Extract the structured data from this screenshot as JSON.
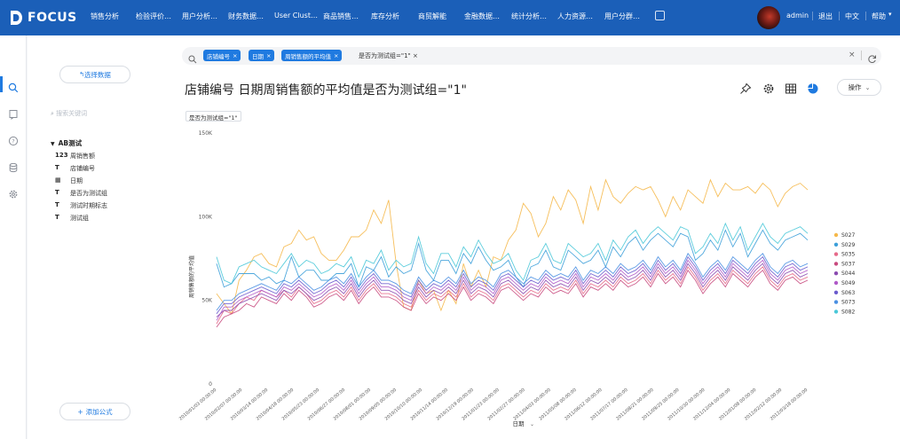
{
  "app": {
    "logo_text": "FOCUS"
  },
  "nav": [
    "销售分析",
    "检验评价…",
    "用户分析…",
    "财务数据…",
    "User Clust…",
    "商品销售…",
    "库存分析",
    "商贸解能",
    "金融数据…",
    "统计分析…",
    "人力资源…",
    "用户分群…"
  ],
  "user": {
    "name": "admin",
    "logout": "退出",
    "lang": "中文",
    "help": "帮助"
  },
  "left": {
    "select_data": "选择数据",
    "search_placeholder": "搜索关键词",
    "tree_title": "AB测试",
    "fields": [
      {
        "type": "123",
        "label": "周销售额"
      },
      {
        "type": "T",
        "label": "店铺编号"
      },
      {
        "type": "cal",
        "label": "日期"
      },
      {
        "type": "T",
        "label": "是否为测试组"
      },
      {
        "type": "T",
        "label": "测试时期标志"
      },
      {
        "type": "T",
        "label": "测试组"
      }
    ],
    "add_formula": "添加公式"
  },
  "filter": {
    "chips": [
      "店铺编号",
      "日期",
      "周销售额的平均值"
    ],
    "text": "是否为测试组=\"1\""
  },
  "title": "店铺编号 日期周销售额的平均值是否为测试组=\"1\"",
  "ops_label": "操作",
  "filter_badge": "是否为测试组=\"1\"",
  "colors": {
    "topbar": "#1b5fb8",
    "accent": "#1f7ae0"
  },
  "chart_data": {
    "type": "line",
    "xlabel": "日期",
    "ylabel": "周销售额的平均值",
    "ylim": [
      0,
      150000
    ],
    "yticks": [
      "150K",
      "100K",
      "50K",
      "0"
    ],
    "xticks": [
      "2010/01/03 00:00:00",
      "2010/02/07 00:00:00",
      "2010/03/14 00:00:00",
      "2010/04/18 00:00:00",
      "2010/05/23 00:00:00",
      "2010/06/27 00:00:00",
      "2010/08/01 00:00:00",
      "2010/09/05 00:00:00",
      "2010/10/10 00:00:00",
      "2010/11/14 00:00:00",
      "2010/12/19 00:00:00",
      "2011/01/23 00:00:00",
      "2011/02/27 00:00:00",
      "2011/04/03 00:00:00",
      "2011/05/08 00:00:00",
      "2011/06/12 00:00:00",
      "2011/07/17 00:00:00",
      "2011/08/21 00:00:00",
      "2011/09/25 00:00:00",
      "2011/10/30 00:00:00",
      "2011/12/04 00:00:00",
      "2012/01/08 00:00:00",
      "2012/02/12 00:00:00",
      "2012/03/18 00:00:00"
    ],
    "legend_position": "right",
    "series": [
      {
        "name": "S027",
        "color": "#f5b84a",
        "values": [
          54000,
          48000,
          42000,
          62000,
          68000,
          76000,
          78000,
          72000,
          70000,
          82000,
          84000,
          92000,
          86000,
          88000,
          78000,
          74000,
          74000,
          80000,
          88000,
          88000,
          92000,
          104000,
          96000,
          110000,
          72000,
          46000,
          44000,
          62000,
          54000,
          56000,
          44000,
          56000,
          48000,
          72000,
          58000,
          68000,
          58000,
          76000,
          74000,
          86000,
          92000,
          108000,
          102000,
          88000,
          96000,
          112000,
          104000,
          116000,
          110000,
          96000,
          118000,
          104000,
          122000,
          112000,
          108000,
          114000,
          118000,
          116000,
          118000,
          110000,
          100000,
          112000,
          104000,
          116000,
          112000,
          108000,
          122000,
          112000,
          120000,
          116000,
          116000,
          118000,
          114000,
          120000,
          116000,
          106000,
          114000,
          118000,
          120000,
          116000
        ]
      },
      {
        "name": "S029",
        "color": "#3c9fd9",
        "values": [
          72000,
          58000,
          60000,
          66000,
          66000,
          66000,
          62000,
          64000,
          60000,
          62000,
          76000,
          64000,
          68000,
          68000,
          62000,
          62000,
          66000,
          66000,
          72000,
          58000,
          70000,
          68000,
          76000,
          64000,
          70000,
          66000,
          68000,
          84000,
          68000,
          62000,
          74000,
          74000,
          66000,
          78000,
          72000,
          82000,
          74000,
          68000,
          70000,
          74000,
          64000,
          58000,
          70000,
          72000,
          80000,
          70000,
          68000,
          80000,
          76000,
          72000,
          74000,
          80000,
          70000,
          82000,
          76000,
          84000,
          88000,
          80000,
          86000,
          90000,
          86000,
          82000,
          90000,
          88000,
          74000,
          78000,
          86000,
          80000,
          92000,
          82000,
          90000,
          76000,
          84000,
          92000,
          84000,
          80000,
          86000,
          88000,
          90000,
          86000
        ]
      },
      {
        "name": "S035",
        "color": "#e66a8a",
        "values": [
          36000,
          44000,
          42000,
          48000,
          52000,
          50000,
          56000,
          54000,
          52000,
          56000,
          52000,
          58000,
          54000,
          48000,
          50000,
          54000,
          56000,
          52000,
          58000,
          50000,
          56000,
          60000,
          54000,
          54000,
          52000,
          48000,
          46000,
          56000,
          50000,
          54000,
          52000,
          56000,
          52000,
          60000,
          52000,
          56000,
          54000,
          50000,
          58000,
          60000,
          56000,
          52000,
          56000,
          54000,
          60000,
          56000,
          58000,
          56000,
          62000,
          54000,
          60000,
          58000,
          62000,
          58000,
          64000,
          60000,
          62000,
          66000,
          60000,
          68000,
          62000,
          66000,
          60000,
          70000,
          64000,
          56000,
          62000,
          66000,
          60000,
          68000,
          64000,
          60000,
          66000,
          70000,
          62000,
          58000,
          64000,
          66000,
          62000,
          64000
        ]
      },
      {
        "name": "S037",
        "color": "#c84a7e",
        "values": [
          34000,
          40000,
          42000,
          44000,
          48000,
          46000,
          52000,
          50000,
          48000,
          54000,
          50000,
          56000,
          52000,
          46000,
          48000,
          52000,
          54000,
          50000,
          56000,
          48000,
          54000,
          58000,
          52000,
          52000,
          50000,
          46000,
          44000,
          54000,
          48000,
          52000,
          50000,
          54000,
          50000,
          58000,
          50000,
          54000,
          52000,
          48000,
          56000,
          58000,
          54000,
          50000,
          54000,
          52000,
          58000,
          54000,
          56000,
          54000,
          60000,
          52000,
          58000,
          56000,
          60000,
          56000,
          62000,
          58000,
          60000,
          64000,
          58000,
          66000,
          60000,
          64000,
          58000,
          68000,
          62000,
          54000,
          60000,
          64000,
          58000,
          66000,
          62000,
          58000,
          64000,
          68000,
          60000,
          56000,
          62000,
          64000,
          60000,
          62000
        ]
      },
      {
        "name": "S044",
        "color": "#8a4bb0",
        "values": [
          40000,
          44000,
          44000,
          48000,
          50000,
          52000,
          54000,
          52000,
          50000,
          56000,
          54000,
          58000,
          54000,
          50000,
          52000,
          56000,
          58000,
          54000,
          60000,
          52000,
          58000,
          62000,
          56000,
          56000,
          54000,
          50000,
          48000,
          58000,
          52000,
          56000,
          54000,
          58000,
          54000,
          62000,
          54000,
          58000,
          56000,
          52000,
          60000,
          62000,
          58000,
          54000,
          58000,
          56000,
          62000,
          58000,
          60000,
          58000,
          64000,
          56000,
          62000,
          60000,
          64000,
          60000,
          66000,
          62000,
          64000,
          68000,
          62000,
          70000,
          64000,
          68000,
          62000,
          72000,
          66000,
          58000,
          64000,
          68000,
          62000,
          70000,
          66000,
          62000,
          68000,
          72000,
          64000,
          60000,
          66000,
          68000,
          64000,
          66000
        ]
      },
      {
        "name": "S049",
        "color": "#b05ac8",
        "values": [
          38000,
          46000,
          46000,
          50000,
          52000,
          54000,
          56000,
          54000,
          52000,
          58000,
          56000,
          60000,
          56000,
          52000,
          54000,
          58000,
          60000,
          56000,
          62000,
          54000,
          60000,
          64000,
          58000,
          58000,
          56000,
          52000,
          50000,
          60000,
          54000,
          58000,
          56000,
          60000,
          56000,
          64000,
          56000,
          60000,
          58000,
          54000,
          62000,
          64000,
          60000,
          56000,
          60000,
          58000,
          64000,
          60000,
          62000,
          60000,
          66000,
          58000,
          64000,
          62000,
          66000,
          62000,
          68000,
          64000,
          66000,
          70000,
          64000,
          72000,
          66000,
          70000,
          64000,
          74000,
          68000,
          60000,
          66000,
          70000,
          64000,
          72000,
          68000,
          64000,
          70000,
          74000,
          66000,
          62000,
          68000,
          70000,
          66000,
          68000
        ]
      },
      {
        "name": "S063",
        "color": "#6a5acd",
        "values": [
          42000,
          48000,
          48000,
          52000,
          54000,
          56000,
          58000,
          56000,
          54000,
          60000,
          58000,
          62000,
          58000,
          54000,
          56000,
          60000,
          62000,
          58000,
          64000,
          56000,
          62000,
          66000,
          60000,
          60000,
          58000,
          54000,
          52000,
          62000,
          56000,
          60000,
          58000,
          62000,
          58000,
          66000,
          58000,
          62000,
          60000,
          56000,
          64000,
          66000,
          62000,
          58000,
          62000,
          60000,
          66000,
          62000,
          64000,
          62000,
          68000,
          60000,
          66000,
          64000,
          68000,
          64000,
          70000,
          66000,
          68000,
          72000,
          66000,
          74000,
          68000,
          72000,
          66000,
          76000,
          70000,
          62000,
          68000,
          72000,
          66000,
          74000,
          70000,
          66000,
          72000,
          76000,
          68000,
          64000,
          70000,
          72000,
          68000,
          70000
        ]
      },
      {
        "name": "S073",
        "color": "#4a90e2",
        "values": [
          44000,
          50000,
          50000,
          54000,
          56000,
          58000,
          60000,
          58000,
          56000,
          62000,
          60000,
          64000,
          60000,
          56000,
          58000,
          62000,
          64000,
          60000,
          66000,
          58000,
          64000,
          68000,
          62000,
          62000,
          60000,
          56000,
          54000,
          64000,
          58000,
          62000,
          60000,
          64000,
          60000,
          68000,
          60000,
          64000,
          62000,
          58000,
          66000,
          68000,
          64000,
          60000,
          64000,
          62000,
          68000,
          64000,
          66000,
          64000,
          70000,
          62000,
          68000,
          66000,
          70000,
          66000,
          72000,
          68000,
          70000,
          74000,
          68000,
          76000,
          70000,
          74000,
          68000,
          78000,
          72000,
          64000,
          70000,
          74000,
          68000,
          76000,
          72000,
          68000,
          74000,
          78000,
          70000,
          66000,
          72000,
          74000,
          70000,
          72000
        ]
      },
      {
        "name": "S082",
        "color": "#4ac8d8",
        "values": [
          76000,
          62000,
          60000,
          70000,
          72000,
          74000,
          70000,
          68000,
          66000,
          72000,
          78000,
          70000,
          74000,
          72000,
          66000,
          68000,
          72000,
          70000,
          76000,
          64000,
          74000,
          72000,
          80000,
          68000,
          74000,
          70000,
          72000,
          88000,
          72000,
          66000,
          78000,
          78000,
          70000,
          82000,
          76000,
          86000,
          78000,
          72000,
          74000,
          78000,
          68000,
          62000,
          74000,
          76000,
          84000,
          74000,
          72000,
          84000,
          80000,
          76000,
          78000,
          84000,
          74000,
          86000,
          80000,
          88000,
          92000,
          84000,
          90000,
          94000,
          90000,
          86000,
          94000,
          92000,
          78000,
          82000,
          90000,
          84000,
          96000,
          86000,
          94000,
          80000,
          88000,
          96000,
          88000,
          84000,
          90000,
          92000,
          94000,
          90000
        ]
      }
    ]
  }
}
